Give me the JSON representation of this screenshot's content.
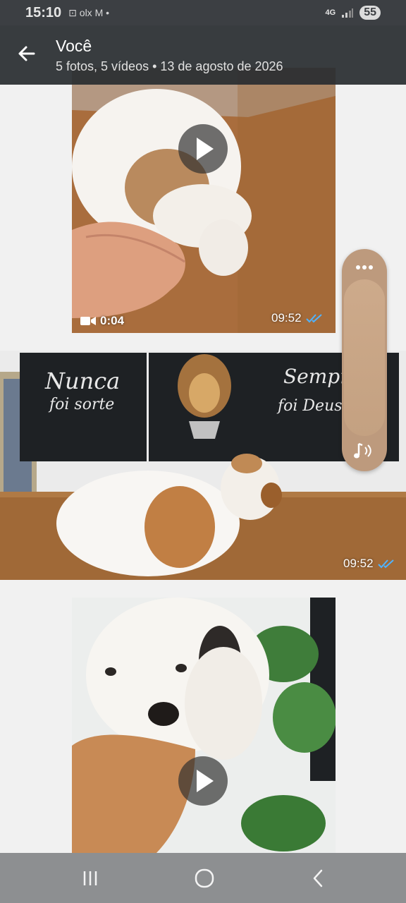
{
  "status_bar": {
    "time": "15:10",
    "notifications": "⊡ olx M •",
    "network": "4G",
    "battery": "55"
  },
  "header": {
    "title": "Você",
    "subtitle": "5 fotos, 5 vídeos  •  13 de agosto de 2026"
  },
  "media": [
    {
      "type": "video",
      "duration": "0:04",
      "time": "09:52"
    },
    {
      "type": "photo",
      "time": "09:52",
      "poster_left_line1": "Nunca",
      "poster_left_line2": "foi sorte",
      "poster_right_line1": "Sempre",
      "poster_right_line2": "foi Deus"
    },
    {
      "type": "video"
    }
  ],
  "colors": {
    "header_bg": "#2c3034",
    "check_blue": "#4fb3ff",
    "float_ctrl": "#bd9a7d",
    "nav_bar": "#8d8f91"
  }
}
